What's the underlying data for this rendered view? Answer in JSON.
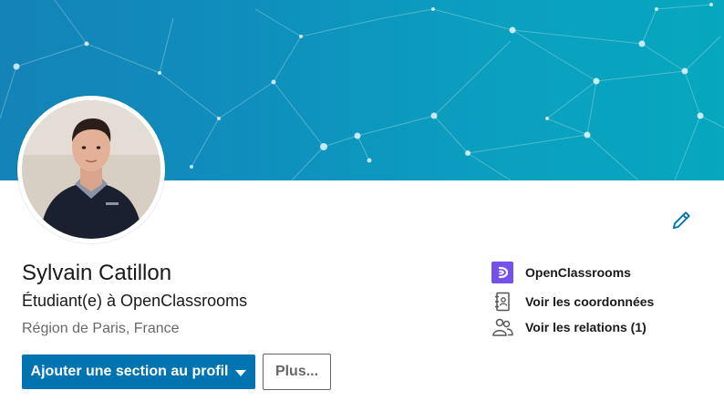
{
  "profile": {
    "name": "Sylvain Catillon",
    "headline": "Étudiant(e) à OpenClassrooms",
    "location": "Région de Paris, France"
  },
  "actions": {
    "add_section_label": "Ajouter une section au profil",
    "more_label": "Plus..."
  },
  "sidebar": {
    "company": "OpenClassrooms",
    "contact_info": "Voir les coordonnées",
    "connections": "Voir les relations (1)"
  },
  "icons": {
    "edit": "pencil-icon",
    "company": "openclassrooms-logo-icon",
    "contact": "address-book-icon",
    "connections": "people-icon",
    "dropdown": "caret-down-icon"
  },
  "colors": {
    "primary": "#0073b1",
    "banner_start": "#1483b8",
    "banner_end": "#07a7bf",
    "company_logo": "#7451eb"
  }
}
